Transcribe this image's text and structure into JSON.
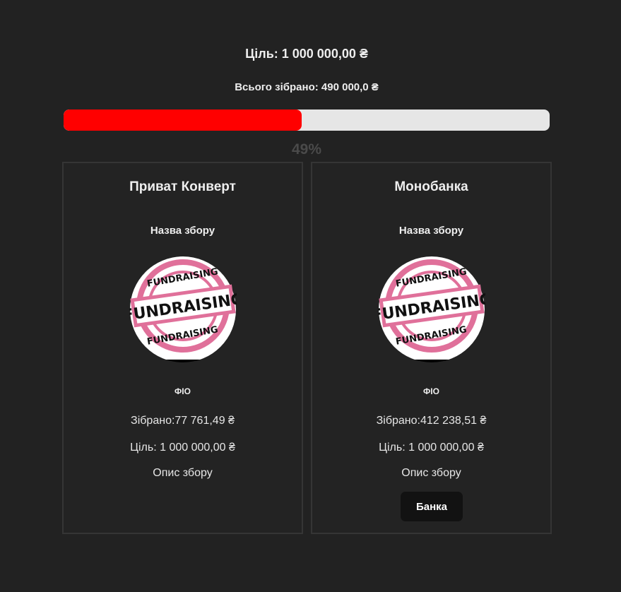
{
  "summary": {
    "goal_text": "Ціль: 1 000 000,00 ₴",
    "total_text": "Всього зібрано: 490 000,0 ₴",
    "progress_fraction": 0.49,
    "progress_percent_text": "49%",
    "progress_fill_color": "#ff0000",
    "progress_track_color": "#e6e6e6"
  },
  "cards": [
    {
      "title": "Приват Конверт",
      "campaign_name": "Назва збору",
      "image_icon": "fundraising-stamp-icon",
      "image_text": "FUNDRAISING",
      "fio": "ФІО",
      "collected_text": "Зібрано:77 761,49 ₴",
      "goal_text": "Ціль: 1 000 000,00 ₴",
      "description": "Опис збору"
    },
    {
      "title": "Монобанка",
      "campaign_name": "Назва збору",
      "image_icon": "fundraising-stamp-icon",
      "image_text": "FUNDRAISING",
      "fio": "ФІО",
      "collected_text": "Зібрано:412 238,51 ₴",
      "goal_text": "Ціль: 1 000 000,00 ₴",
      "description": "Опис збору",
      "button_label": "Банка"
    }
  ],
  "colors": {
    "background": "#222222",
    "stamp_pink": "#e0709a",
    "button_bg": "#121212"
  }
}
